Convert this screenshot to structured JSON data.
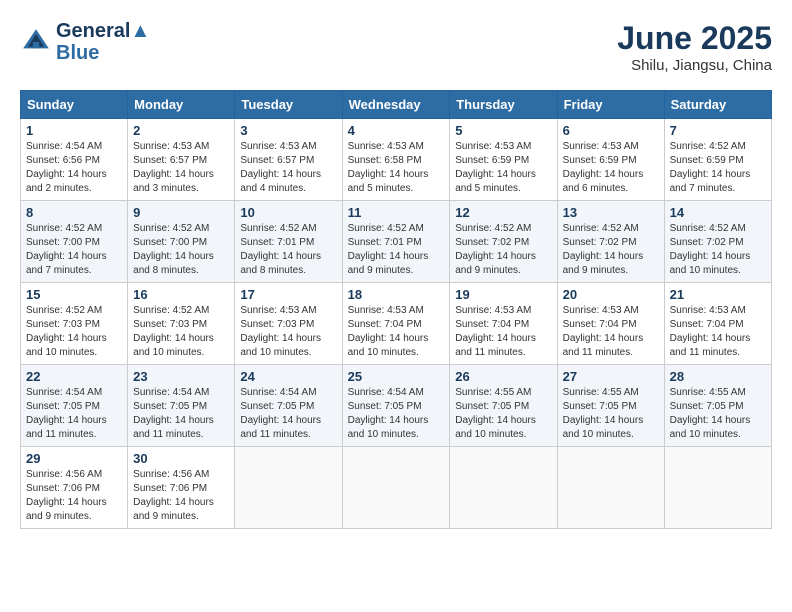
{
  "header": {
    "logo_line1": "General",
    "logo_line2": "Blue",
    "month": "June 2025",
    "location": "Shilu, Jiangsu, China"
  },
  "weekdays": [
    "Sunday",
    "Monday",
    "Tuesday",
    "Wednesday",
    "Thursday",
    "Friday",
    "Saturday"
  ],
  "weeks": [
    [
      {
        "day": 1,
        "info": "Sunrise: 4:54 AM\nSunset: 6:56 PM\nDaylight: 14 hours\nand 2 minutes."
      },
      {
        "day": 2,
        "info": "Sunrise: 4:53 AM\nSunset: 6:57 PM\nDaylight: 14 hours\nand 3 minutes."
      },
      {
        "day": 3,
        "info": "Sunrise: 4:53 AM\nSunset: 6:57 PM\nDaylight: 14 hours\nand 4 minutes."
      },
      {
        "day": 4,
        "info": "Sunrise: 4:53 AM\nSunset: 6:58 PM\nDaylight: 14 hours\nand 5 minutes."
      },
      {
        "day": 5,
        "info": "Sunrise: 4:53 AM\nSunset: 6:59 PM\nDaylight: 14 hours\nand 5 minutes."
      },
      {
        "day": 6,
        "info": "Sunrise: 4:53 AM\nSunset: 6:59 PM\nDaylight: 14 hours\nand 6 minutes."
      },
      {
        "day": 7,
        "info": "Sunrise: 4:52 AM\nSunset: 6:59 PM\nDaylight: 14 hours\nand 7 minutes."
      }
    ],
    [
      {
        "day": 8,
        "info": "Sunrise: 4:52 AM\nSunset: 7:00 PM\nDaylight: 14 hours\nand 7 minutes."
      },
      {
        "day": 9,
        "info": "Sunrise: 4:52 AM\nSunset: 7:00 PM\nDaylight: 14 hours\nand 8 minutes."
      },
      {
        "day": 10,
        "info": "Sunrise: 4:52 AM\nSunset: 7:01 PM\nDaylight: 14 hours\nand 8 minutes."
      },
      {
        "day": 11,
        "info": "Sunrise: 4:52 AM\nSunset: 7:01 PM\nDaylight: 14 hours\nand 9 minutes."
      },
      {
        "day": 12,
        "info": "Sunrise: 4:52 AM\nSunset: 7:02 PM\nDaylight: 14 hours\nand 9 minutes."
      },
      {
        "day": 13,
        "info": "Sunrise: 4:52 AM\nSunset: 7:02 PM\nDaylight: 14 hours\nand 9 minutes."
      },
      {
        "day": 14,
        "info": "Sunrise: 4:52 AM\nSunset: 7:02 PM\nDaylight: 14 hours\nand 10 minutes."
      }
    ],
    [
      {
        "day": 15,
        "info": "Sunrise: 4:52 AM\nSunset: 7:03 PM\nDaylight: 14 hours\nand 10 minutes."
      },
      {
        "day": 16,
        "info": "Sunrise: 4:52 AM\nSunset: 7:03 PM\nDaylight: 14 hours\nand 10 minutes."
      },
      {
        "day": 17,
        "info": "Sunrise: 4:53 AM\nSunset: 7:03 PM\nDaylight: 14 hours\nand 10 minutes."
      },
      {
        "day": 18,
        "info": "Sunrise: 4:53 AM\nSunset: 7:04 PM\nDaylight: 14 hours\nand 10 minutes."
      },
      {
        "day": 19,
        "info": "Sunrise: 4:53 AM\nSunset: 7:04 PM\nDaylight: 14 hours\nand 11 minutes."
      },
      {
        "day": 20,
        "info": "Sunrise: 4:53 AM\nSunset: 7:04 PM\nDaylight: 14 hours\nand 11 minutes."
      },
      {
        "day": 21,
        "info": "Sunrise: 4:53 AM\nSunset: 7:04 PM\nDaylight: 14 hours\nand 11 minutes."
      }
    ],
    [
      {
        "day": 22,
        "info": "Sunrise: 4:54 AM\nSunset: 7:05 PM\nDaylight: 14 hours\nand 11 minutes."
      },
      {
        "day": 23,
        "info": "Sunrise: 4:54 AM\nSunset: 7:05 PM\nDaylight: 14 hours\nand 11 minutes."
      },
      {
        "day": 24,
        "info": "Sunrise: 4:54 AM\nSunset: 7:05 PM\nDaylight: 14 hours\nand 11 minutes."
      },
      {
        "day": 25,
        "info": "Sunrise: 4:54 AM\nSunset: 7:05 PM\nDaylight: 14 hours\nand 10 minutes."
      },
      {
        "day": 26,
        "info": "Sunrise: 4:55 AM\nSunset: 7:05 PM\nDaylight: 14 hours\nand 10 minutes."
      },
      {
        "day": 27,
        "info": "Sunrise: 4:55 AM\nSunset: 7:05 PM\nDaylight: 14 hours\nand 10 minutes."
      },
      {
        "day": 28,
        "info": "Sunrise: 4:55 AM\nSunset: 7:05 PM\nDaylight: 14 hours\nand 10 minutes."
      }
    ],
    [
      {
        "day": 29,
        "info": "Sunrise: 4:56 AM\nSunset: 7:06 PM\nDaylight: 14 hours\nand 9 minutes."
      },
      {
        "day": 30,
        "info": "Sunrise: 4:56 AM\nSunset: 7:06 PM\nDaylight: 14 hours\nand 9 minutes."
      },
      {
        "day": null,
        "info": ""
      },
      {
        "day": null,
        "info": ""
      },
      {
        "day": null,
        "info": ""
      },
      {
        "day": null,
        "info": ""
      },
      {
        "day": null,
        "info": ""
      }
    ]
  ]
}
